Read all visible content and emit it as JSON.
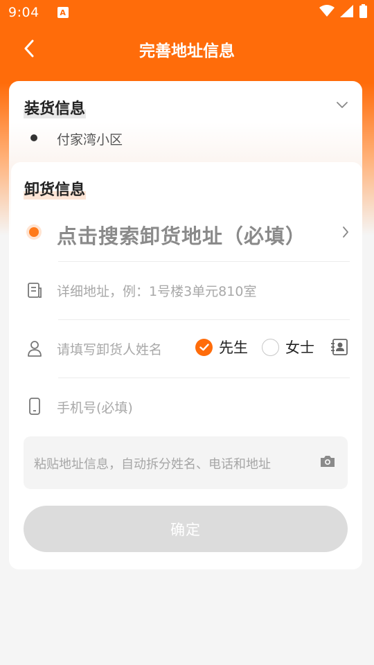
{
  "status_bar": {
    "time": "9:04",
    "app_badge": "A"
  },
  "header": {
    "title": "完善地址信息",
    "back_icon": "chevron-left-icon"
  },
  "colors": {
    "brand": "#ff6c0a",
    "brand_light": "#ffe4d2",
    "button_disabled": "#dcdcdc"
  },
  "loading": {
    "title": "装货信息",
    "address": "付家湾小区",
    "collapse_icon": "chevron-down-icon"
  },
  "unloading": {
    "title": "卸货信息",
    "search_placeholder": "点击搜索卸货地址（必填）",
    "detail_placeholder": "详细地址，例：1号楼3单元810室",
    "name_placeholder": "请填写卸货人姓名",
    "gender_options": [
      {
        "label": "先生",
        "selected": true
      },
      {
        "label": "女士",
        "selected": false
      }
    ],
    "phone_placeholder": "手机号(必填)",
    "paste_placeholder": "粘贴地址信息，自动拆分姓名、电话和地址"
  },
  "confirm_label": "确定"
}
